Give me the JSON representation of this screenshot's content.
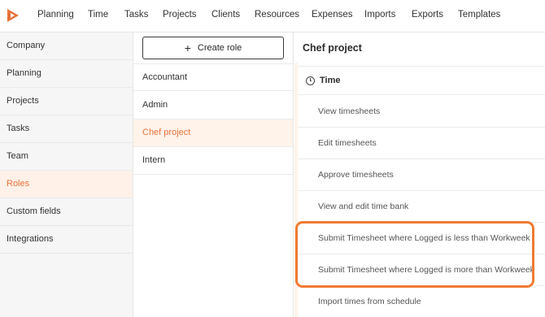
{
  "app": {
    "logo_icon": "brand-play-logo-icon",
    "accent_color": "#e8733a"
  },
  "nav": {
    "items": [
      "Planning",
      "Time",
      "Tasks",
      "Projects",
      "Clients",
      "Resources",
      "Expenses",
      "Imports",
      "Exports",
      "Templates"
    ]
  },
  "sidebar": {
    "items": [
      "Company",
      "Planning",
      "Projects",
      "Tasks",
      "Team",
      "Roles",
      "Custom fields",
      "Integrations"
    ],
    "active": "Roles"
  },
  "roles": {
    "create_label": "Create role",
    "create_icon": "plus-icon",
    "items": [
      "Accountant",
      "Admin",
      "Chef project",
      "Intern"
    ],
    "active": "Chef project"
  },
  "panel": {
    "title": "Chef project",
    "section": {
      "icon": "clock-icon",
      "label": "Time"
    },
    "permissions": [
      "View timesheets",
      "Edit timesheets",
      "Approve timesheets",
      "View and edit time bank",
      "Submit Timesheet where Logged is less than Workweek",
      "Submit Timesheet where Logged is more than Workweek",
      "Import times from schedule"
    ],
    "highlight_color": "#f07a33"
  }
}
